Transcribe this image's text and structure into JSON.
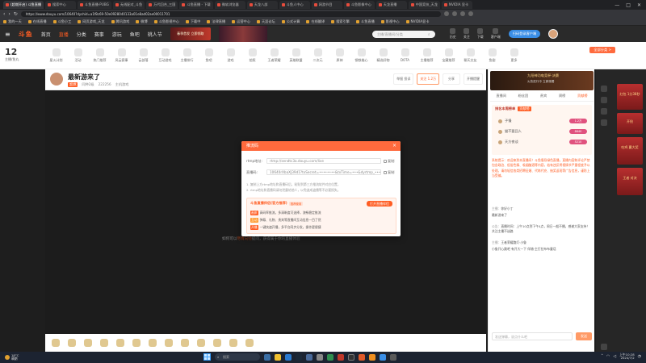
{
  "browser": {
    "tabs": [
      "(超燃开启) 斗鱼直播",
      "搜索中心",
      "斗鱼直播-PUBG",
      "无线配对_斗鱼",
      "万代回合_三国",
      "斗鱼直播 - 下载",
      "微软浏览器",
      "天龙八部",
      "斗鱼人中心",
      "网游节目",
      "斗鱼影像中心",
      "天龙直播",
      "中国竞技_天龙",
      "NVIDIA 显卡",
      "英伟达 GPU",
      "通信卡/1M",
      "上海黄金网"
    ],
    "url": "https://www.douyu.com/10640?dyshid=a1f8c69-50e0928040133a01e8ad02ae00011701",
    "bookmarks": [
      "我的一天",
      "在线直播",
      "斗鱼小工",
      "网页游戏_天龙",
      "腾讯游戏",
      "微博",
      "斗鱼影视中心",
      "下载中",
      "法律直播",
      "运营中心",
      "天涯论坛",
      "公式计算",
      "在线翻译",
      "搜索引擎",
      "斗鱼直播",
      "影视中心",
      "NVIDIA显卡",
      "通信卡中心",
      "英伟达",
      "斗鱼会员"
    ],
    "window_controls": [
      "—",
      "□",
      "✕"
    ]
  },
  "header": {
    "logo": "斗鱼",
    "nav": [
      "首页",
      "直播",
      "分类",
      "赛事",
      "游玩",
      "鱼吧",
      "桃人节"
    ],
    "promo": "春季首发 立即领取",
    "search_placeholder": "主播/直播间/分类",
    "icons": [
      "历史",
      "关注",
      "下载",
      "客户端"
    ],
    "download_button": "扫码登录客户端"
  },
  "category_bar": {
    "date_number": "12",
    "date_label": "主播/鱼丸",
    "items": [
      "星火计划",
      "活动",
      "热门推荐",
      "风云赛事",
      "云部落",
      "互动游戏",
      "主播排行",
      "鱼吧",
      "游戏",
      "拍照",
      "王者荣耀",
      "英雄联盟",
      "二次元",
      "原神",
      "钢铁雄心",
      "精选好物",
      "DOTA",
      "主播推荐",
      "宝藏推荐",
      "聊天交友",
      "鱼翅",
      "更多"
    ],
    "all_button": "全部分类 >"
  },
  "room": {
    "title": "最新游来了",
    "tag": "超燃",
    "meta": [
      "同种2级",
      "222256",
      "主机游戏"
    ],
    "actions": [
      "举报 投诉",
      "关注 1.2万",
      "分享",
      "开播提醒"
    ]
  },
  "player": {
    "hint_prefix": "如何可以",
    "hint_link": "尽情向他",
    "hint_suffix": "提问，获得属于你的直播体验"
  },
  "modal": {
    "title": "推流码",
    "close": "×",
    "rtmp_label": "rtmp地址:",
    "rtmp_value": "rtmp://sendtc3a.douyu.com/live",
    "key_label": "直播码:",
    "key_value": "10640rXbaXJ39d1?txSecret=••••••••&txTime=•••&dyrtmp_••••ld&origin=tct",
    "copy_label": "复制",
    "note1": "1. 复制上方rtmp地址和直播码后，粘贴到第三方推流软件对应位置。",
    "note2": "2. rtmp地址和直播码请勿泄露给他人，以免造成盗播等不必要损失。",
    "promo_title": "斗鱼直播伴侣(官方推荐)",
    "promo_badge": "推荐使用",
    "promo_button": "打开直播伴侣",
    "promo_lines": [
      {
        "tag": "画质",
        "text": "高码率推流，多清晰度可选择，流畅稳定推流"
      },
      {
        "tag": "互动",
        "text": "弹幕、礼物、贵宾等直播间互动信息一目了然"
      },
      {
        "tag": "开播",
        "text": "一键快速开播，多平台同步分发，操作更便捷"
      }
    ]
  },
  "sidebar": {
    "banner_title": "九阳神功电竞杯·决赛",
    "banner_sub": "火热进行中 立即观看",
    "tabs": [
      "直播间",
      "粉丝团",
      "贵宾",
      "周榜",
      "贡献榜"
    ],
    "rank_head": "排名本周榜单",
    "rank_highlight": "贡献榜",
    "rank_items": [
      {
        "name": "子慢",
        "badge": "1.2万"
      },
      {
        "name": "猫不要回人",
        "badge": "8640"
      },
      {
        "name": "天方夜谈",
        "badge": "5210"
      }
    ],
    "system_message": "系统提示：欢迎来到本直播间！斗鱼倡导绿色直播，直播内容和评论严禁包含政治、低俗色情、吸烟酗酒等内容，若有违反将视情节严重程度予以处理。请勿轻信各类招聘征婚、代练代充、抽奖返现等广告信息，谨防上当受骗。",
    "chats": [
      {
        "who": "主播：",
        "text": "你好小丁"
      },
      {
        "who": "",
        "text": "最新游来了"
      },
      {
        "who": "公告：",
        "text": "直播时间：上午10点到下午4点，周日一般不播，感谢大家支持！关注主播不迷路"
      },
      {
        "who": "主播：",
        "text": "王者荣耀路灯·小鲁"
      },
      {
        "who": "",
        "text": "小鲁开心跳吧 有开大一下 伴随·主打拉布布童话"
      }
    ],
    "input_placeholder": "发送弹幕，说点什么吧",
    "send_button": "发送"
  },
  "farright": {
    "ads": [
      "红包 1分38秒",
      "开抢",
      "吃鸡 赢大奖",
      "王者 对决"
    ]
  },
  "taskbar": {
    "weather_temp": "18°C",
    "weather_desc": "晴朗",
    "search": "搜索",
    "time": "上午10:28",
    "date": "2024/7/2"
  }
}
